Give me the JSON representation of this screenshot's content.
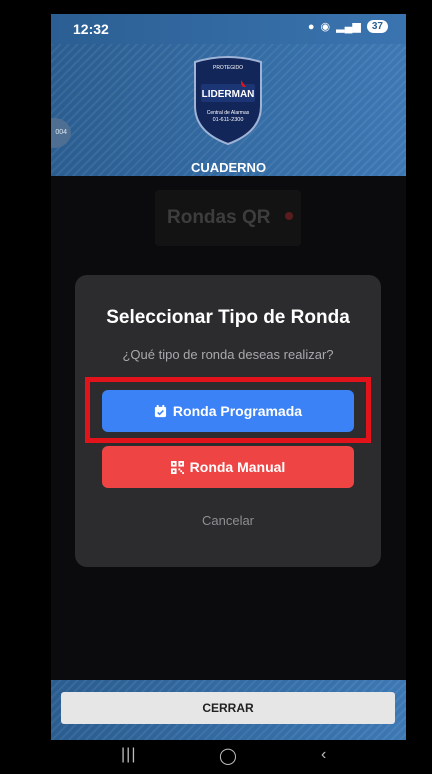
{
  "status_bar": {
    "time": "12:32",
    "battery": "37"
  },
  "header": {
    "logo": {
      "top_text": "PROTEGIDO",
      "brand": "LIDERMAN",
      "line1": "Central de Alarmas",
      "line2": "01-611-2300"
    },
    "title": "CUADERNO"
  },
  "background_card": {
    "title": "Rondas QR"
  },
  "modal": {
    "title": "Seleccionar Tipo de Ronda",
    "subtitle": "¿Qué tipo de ronda deseas realizar?",
    "primary_button": {
      "label": "Ronda Programada",
      "icon": "calendar-icon",
      "color": "#3b82f6"
    },
    "secondary_button": {
      "label": "Ronda Manual",
      "icon": "qr-icon",
      "color": "#ef4444"
    },
    "cancel_label": "Cancelar",
    "highlight_color": "#e3131b"
  },
  "footer": {
    "close_label": "CERRAR"
  },
  "nav": {
    "recents": "|||",
    "home": "◯",
    "back": "‹"
  }
}
